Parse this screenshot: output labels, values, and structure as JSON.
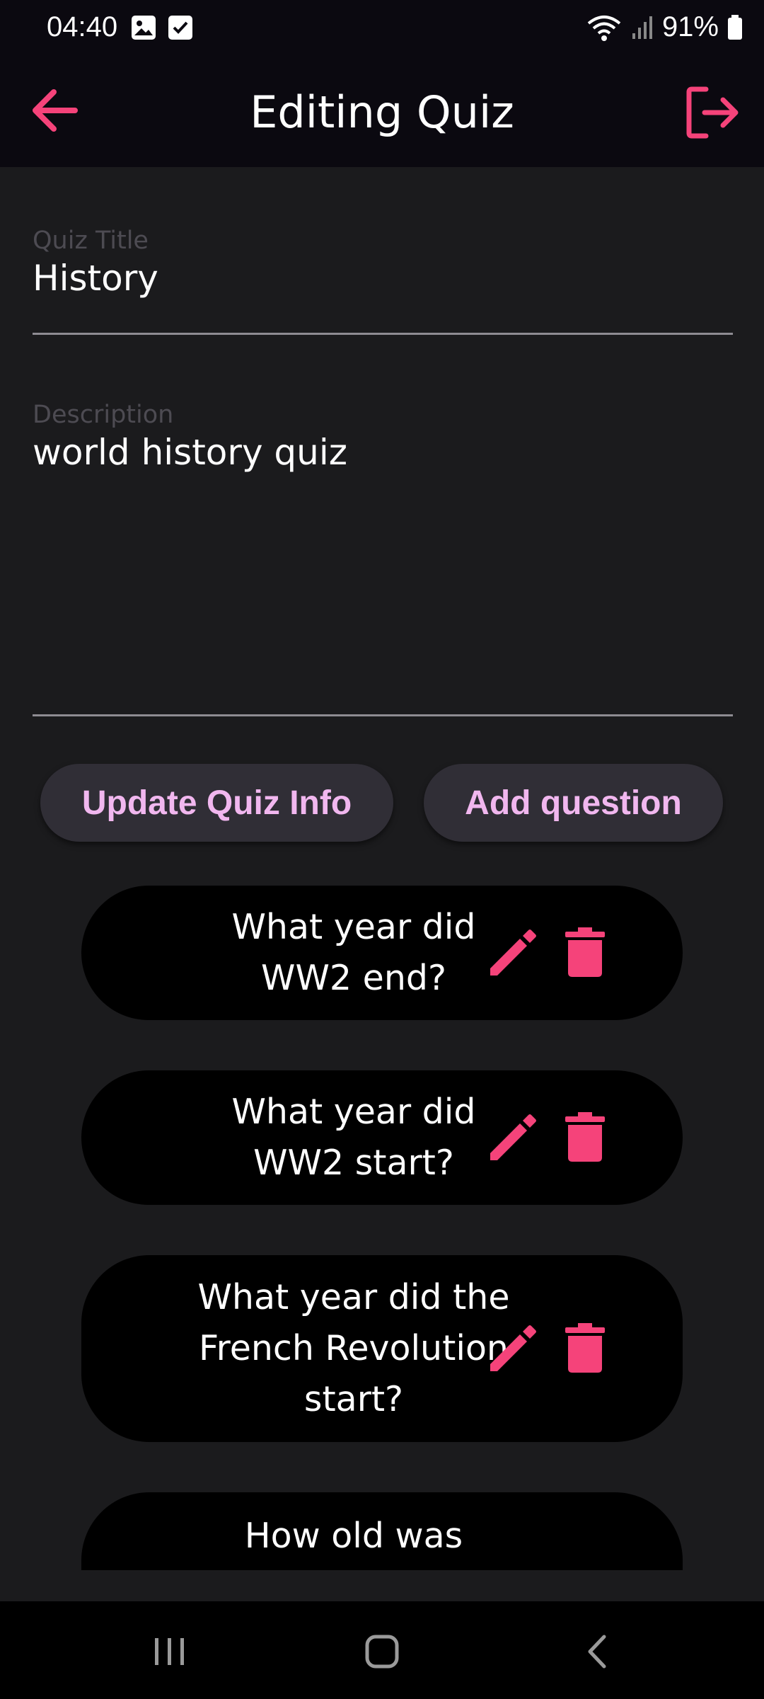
{
  "status_bar": {
    "time": "04:40",
    "battery": "91%",
    "icons": [
      "image-icon",
      "check-box-icon",
      "wifi-icon",
      "signal-icon",
      "battery-icon"
    ]
  },
  "app_bar": {
    "title": "Editing Quiz",
    "back_icon": "arrow-left-icon",
    "logout_icon": "logout-icon"
  },
  "form": {
    "title_label": "Quiz Title",
    "title_value": "History",
    "description_label": "Description",
    "description_value": "world history quiz"
  },
  "actions": {
    "update_label": "Update Quiz Info",
    "add_label": "Add question"
  },
  "questions": [
    {
      "text": "What year did WW2 end?"
    },
    {
      "text": "What year did WW2 start?"
    },
    {
      "text": "What year did the French Revolution start?"
    },
    {
      "text": "How old was"
    }
  ],
  "colors": {
    "accent": "#f5437a",
    "background": "#1b1b1d",
    "bar": "#0b0910",
    "card": "#000000",
    "button_bg": "#302e36",
    "button_text": "#f1b7ef"
  },
  "nav_bar": {
    "icons": [
      "recent-apps-icon",
      "home-icon",
      "back-icon"
    ]
  }
}
